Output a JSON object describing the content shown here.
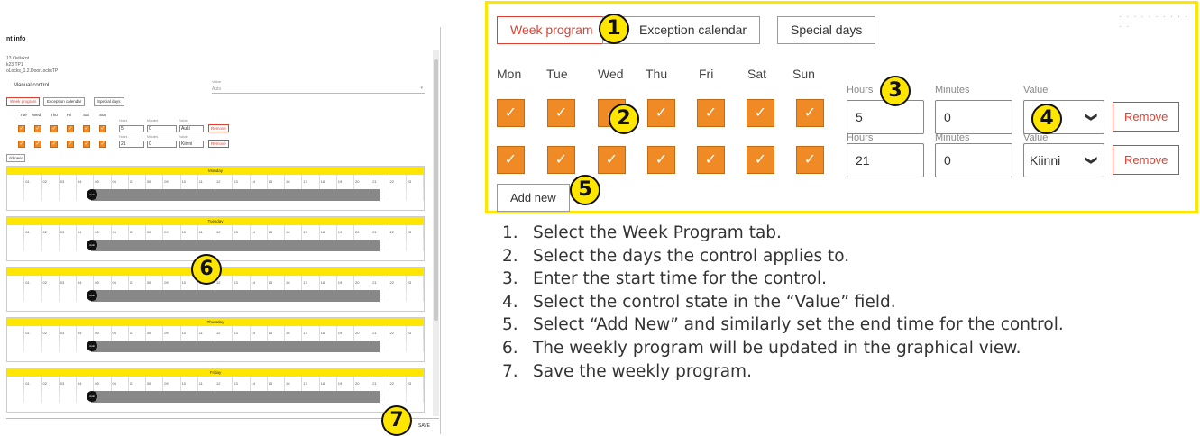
{
  "left": {
    "title": "nt info",
    "info_lines": [
      "13 Ovilukot",
      "k23.TP1",
      "oLocks_1.2.DoorLocksTP"
    ],
    "manual_control": "Manual control",
    "value_label": "Value",
    "value_field": "Auto",
    "tabs": [
      {
        "label": "Week program",
        "active": true
      },
      {
        "label": "Exception calendar",
        "active": false
      },
      {
        "label": "Special days",
        "active": false
      }
    ],
    "days": [
      "Tue",
      "Wed",
      "Thu",
      "Fri",
      "Sat",
      "Sun"
    ],
    "check_glyph": "✓",
    "hours_label": "Hours",
    "minutes_label": "Minutes",
    "value_col_label": "Value",
    "rows": [
      {
        "hours": "5",
        "minutes": "0",
        "value": "Auki"
      },
      {
        "hours": "21",
        "minutes": "0",
        "value": "Kiinni"
      }
    ],
    "remove_label": "Remove",
    "add_new_label": "dd new",
    "day_panels": [
      "Monday",
      "Tuesday",
      "",
      "Thursday",
      "Friday"
    ],
    "hour_ticks": [
      "",
      "01",
      "02",
      "03",
      "04",
      "05",
      "06",
      "07",
      "08",
      "09",
      "10",
      "11",
      "12",
      "13",
      "14",
      "15",
      "16",
      "17",
      "18",
      "19",
      "20",
      "21",
      "22",
      "23"
    ],
    "dot_label": "Auki",
    "save_label": "SAVE"
  },
  "zoom": {
    "tabs": [
      {
        "label": "Week program",
        "active": true
      },
      {
        "label": "Exception calendar",
        "active": false
      },
      {
        "label": "Special days",
        "active": false
      }
    ],
    "days": [
      "Mon",
      "Tue",
      "Wed",
      "Thu",
      "Fri",
      "Sat",
      "Sun"
    ],
    "check_glyph": "✓",
    "row1": {
      "hours_label": "Hours",
      "minutes_label": "Minutes",
      "value_label": "Value",
      "hours": "5",
      "minutes": "0",
      "value": ""
    },
    "row2": {
      "hours_label": "Hours",
      "minutes_label": "Minutes",
      "value_label": "Value",
      "hours": "21",
      "minutes": "0",
      "value": "Kiinni"
    },
    "chevron": "❯",
    "remove_label": "Remove",
    "add_new_label": "Add new"
  },
  "markers": [
    "1",
    "2",
    "3",
    "4",
    "5",
    "6",
    "7"
  ],
  "instructions": [
    {
      "num": "1.",
      "text": "Select the Week Program tab."
    },
    {
      "num": "2.",
      "text": "Select the days the control applies to."
    },
    {
      "num": "3.",
      "text": "Enter the start time for the control."
    },
    {
      "num": "4.",
      "text": "Select the control state in the “Value” field."
    },
    {
      "num": "5.",
      "text": "Select “Add New” and similarly set the end time for the control."
    },
    {
      "num": "6.",
      "text": "The weekly program will be updated in the graphical view."
    },
    {
      "num": "7.",
      "text": "Save the weekly program."
    }
  ],
  "colors": {
    "yellow": "#ffe600",
    "orange": "#f08a24",
    "red": "#e04030",
    "bar_gray": "#888888"
  }
}
